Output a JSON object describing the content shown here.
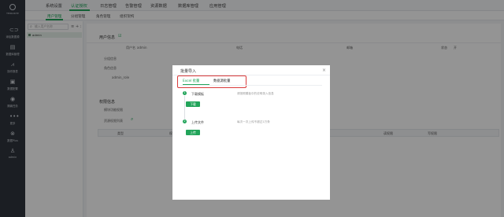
{
  "brand": {
    "name": "TENSORITE"
  },
  "rail": [
    {
      "label": "添加数据源",
      "icon": "link-icon"
    },
    {
      "label": "数据库管理",
      "icon": "database-icon"
    },
    {
      "label": "操作报表",
      "icon": "chart-icon"
    },
    {
      "label": "数据配置",
      "icon": "settings-icon"
    },
    {
      "label": "隔离任务",
      "icon": "task-icon"
    },
    {
      "label": "更多",
      "icon": "more-icon"
    },
    {
      "label": "数据Plus",
      "icon": "plus-icon"
    },
    {
      "label": "admin",
      "icon": "user-icon"
    }
  ],
  "topnav": [
    "系统设置",
    "认证授权",
    "日志管理",
    "告警管理",
    "资源数据",
    "数据库管理",
    "应用管理"
  ],
  "topnav_active": "认证授权",
  "subnav": [
    "用户管理",
    "分组管理",
    "角色管理",
    "组织架构"
  ],
  "subnav_active": "用户管理",
  "tree": {
    "search_placeholder": "输入用户名称",
    "toolbar_a": "≡",
    "toolbar_b": "+ :",
    "item": "admin"
  },
  "main": {
    "user_info_title": "用户信息",
    "username_label": "用户名",
    "username_value": "admin",
    "phone_label": "电话",
    "email_label": "邮箱",
    "status_label": "状态",
    "status_value": "开",
    "group_label": "分组信息",
    "role_label": "角色信息",
    "role_value": "admin_role",
    "perm_title": "权限信息",
    "module_label": "模块功能权限",
    "resource_label": "资源权限列表",
    "columns": [
      "类型",
      "权限",
      "读权限",
      "写权限"
    ]
  },
  "modal": {
    "title": "批量导入",
    "close": "×",
    "tabs": [
      "Excel 批量",
      "数据源批量"
    ],
    "active_tab": "Excel 批量",
    "steps": [
      {
        "num": "1",
        "label": "下载模板",
        "hint": "请按照模板中的说明录入信息",
        "button": "下载"
      },
      {
        "num": "2",
        "label": "上传文件",
        "hint": "每次一次上传不超过1万条",
        "button": "上传"
      }
    ]
  },
  "colors": {
    "accent": "#22a45a",
    "rail_bg": "#2f353d",
    "highlight_border": "#d93a3a"
  }
}
